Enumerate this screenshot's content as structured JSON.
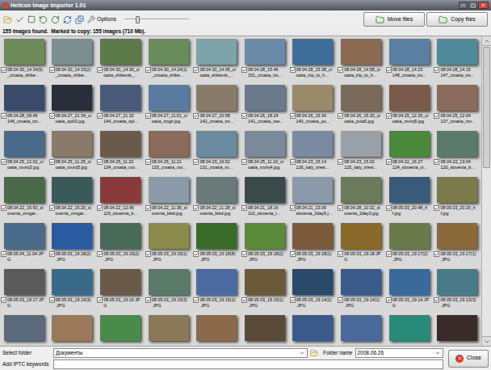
{
  "window": {
    "title": "Helicon Image Importer 1.01"
  },
  "toolbar": {
    "options": "Options",
    "zoom": {
      "level": 0.2
    },
    "buttons": [
      "Move files",
      "Copy files"
    ]
  },
  "status": "155 images found.  Marked to copy: 155 images (710 Mb).",
  "images": [
    {
      "lines": [
        "08.04.30_14.34(5)",
        "_croatia_shibe..."
      ],
      "checked": true,
      "color": "#6f8a5a"
    },
    {
      "lines": [
        "08.04.30_14.33(2)",
        "_croatia_shibe..."
      ],
      "checked": true,
      "color": "#7a8f8e"
    },
    {
      "lines": [
        "08.04.30_14.30_cr",
        "oatia_shibenik_..."
      ],
      "checked": true,
      "color": "#5d7a4a"
    },
    {
      "lines": [
        "08.04.30_14.24(1)",
        "_croatia_shibe..."
      ],
      "checked": true,
      "color": "#6a8c5c"
    },
    {
      "lines": [
        "08.04.30_14.05_cr",
        "oatia_shibenik_..."
      ],
      "checked": true,
      "color": "#7ea3a8"
    },
    {
      "lines": [
        "08.04.28_15.46",
        "151_croatia_tro..."
      ],
      "checked": true,
      "color": "#6b8aa8"
    },
    {
      "lines": [
        "08.04.28_15.38_cr",
        "oatia_trip_to_h..."
      ],
      "checked": true,
      "color": "#3f6d9a"
    },
    {
      "lines": [
        "08.04.28_14.58_cr",
        "oatia_trip_to_h..."
      ],
      "checked": true,
      "color": "#8a6a52"
    },
    {
      "lines": [
        "08.04.28_14.23",
        "148_croatia_tro..."
      ],
      "checked": true,
      "color": "#5a7fa0"
    },
    {
      "lines": [
        "08.04.28_14.15",
        "147_croatia_tro..."
      ],
      "checked": true,
      "color": "#4f8a9a"
    },
    {
      "lines": [
        "08.04.28_09.45",
        "146_croatia_tro..."
      ],
      "checked": true,
      "color": "#3a4a6a"
    },
    {
      "lines": [
        "08.04.27_21.34_cr",
        "oatia_split3.jpg"
      ],
      "checked": true,
      "color": "#2a2e3a"
    },
    {
      "lines": [
        "08.04.27_21.32",
        "144_croatia_spl..."
      ],
      "checked": true,
      "color": "#4a5a7a"
    },
    {
      "lines": [
        "08.04.27_11.01_cr",
        "oatia_trogir.jpg"
      ],
      "checked": true,
      "color": "#5a7aa0"
    },
    {
      "lines": [
        "08.04.27_10.58",
        "142_croatia_tro..."
      ],
      "checked": true,
      "color": "#8a7a6a"
    },
    {
      "lines": [
        "08.04.26_18.24",
        "141_croatia_vse..."
      ],
      "checked": true,
      "color": "#6a7a8a"
    },
    {
      "lines": [
        "08.04.26_15.34",
        "140_croatia_pu..."
      ],
      "checked": true,
      "color": "#9a8a6a"
    },
    {
      "lines": [
        "08.04.26_15.20_cr",
        "oatia_pula5.jpg"
      ],
      "checked": true,
      "color": "#7a6a5a"
    },
    {
      "lines": [
        "08.04.25_12.26_cr",
        "oatia_rovinj5.jpg"
      ],
      "checked": true,
      "color": "#7a5a4a"
    },
    {
      "lines": [
        "08.04.25_12.04",
        "137_croatia_rov..."
      ],
      "checked": true,
      "color": "#8a6a5a"
    },
    {
      "lines": [
        "08.04.25_12.02_cr",
        "oatia_rovinj3.jpg"
      ],
      "checked": true,
      "color": "#4a6a8a"
    },
    {
      "lines": [
        "08.04.25_11.25_cr",
        "oatia_rovinj5.jpg"
      ],
      "checked": true,
      "color": "#8a7a6a"
    },
    {
      "lines": [
        "08.04.25_11.22",
        "134_croatia_rov..."
      ],
      "checked": true,
      "color": "#6a5a4a"
    },
    {
      "lines": [
        "08.04.25_11.21",
        "133_croatia_rov..."
      ],
      "checked": true,
      "color": "#8a6a5a"
    },
    {
      "lines": [
        "08.04.23_16.52",
        "131_croatia_ro..."
      ],
      "checked": true,
      "color": "#6a8aa0"
    },
    {
      "lines": [
        "08.04.25_11.10_cr",
        "oatia_rovinj4.jpg"
      ],
      "checked": true,
      "color": "#7a8a9a"
    },
    {
      "lines": [
        "08.04.23_15.14",
        "126_italy_triest..."
      ],
      "checked": true,
      "color": "#7a8aa0"
    },
    {
      "lines": [
        "08.04.23_15.02",
        "125_italy_triest..."
      ],
      "checked": true,
      "color": "#9aa0a8"
    },
    {
      "lines": [
        "08.04.22_16.27",
        "124_slovenia_vi..."
      ],
      "checked": true,
      "color": "#4a8a3a"
    },
    {
      "lines": [
        "08.04.22_13.04",
        "120_slovenia_b..."
      ],
      "checked": true,
      "color": "#5a7a6a"
    },
    {
      "lines": [
        "08.04.22_15.50_sl",
        "ovenia_vintgar..."
      ],
      "checked": true,
      "color": "#4a6a4a"
    },
    {
      "lines": [
        "08.04.22_15.20_sl",
        "ovenia_vintgar..."
      ],
      "checked": true,
      "color": "#3a5a5a"
    },
    {
      "lines": [
        "08.04.22_12.45",
        "119_slovenia_b..."
      ],
      "checked": true,
      "color": "#8a3a3a"
    },
    {
      "lines": [
        "08.04.22_11.36_sl",
        "ovenia_bled.jpg"
      ],
      "checked": true,
      "color": "#8a9aa8"
    },
    {
      "lines": [
        "08.04.22_11.28_sl",
        "ovenia_bled.jpg"
      ],
      "checked": true,
      "color": "#6a7a7a"
    },
    {
      "lines": [
        "08.04.21_18.16",
        "110_slovenia_l..."
      ],
      "checked": true,
      "color": "#3a4a4a"
    },
    {
      "lines": [
        "08.04.21_13.06",
        "slovenia_2day5.j..."
      ],
      "checked": true,
      "color": "#8a9aaa"
    },
    {
      "lines": [
        "08.04.28_10.32_sl",
        "ovenia_2day3.jpg"
      ],
      "checked": true,
      "color": "#6a7a5a"
    },
    {
      "lines": [
        "08.05.03_20.48_h",
        "f.jpg"
      ],
      "checked": true,
      "color": "#3a5a7a"
    },
    {
      "lines": [
        "08.05.03_20.20_h",
        "f.jpg"
      ],
      "checked": true,
      "color": "#7a7a4a"
    },
    {
      "lines": [
        "08.05.04_11.04.JP",
        "G"
      ],
      "checked": true,
      "color": "#4a6a8a"
    },
    {
      "lines": [
        "08.05.03_19.18(2)",
        ".JPG"
      ],
      "checked": true,
      "color": "#2a5aa0"
    },
    {
      "lines": [
        "08.05.03_19.19(2)",
        ".JPG"
      ],
      "checked": true,
      "color": "#4a6a5a"
    },
    {
      "lines": [
        "08.05.03_19.19(1)",
        ".JPG"
      ],
      "checked": true,
      "color": "#8a8a4a"
    },
    {
      "lines": [
        "08.05.03_19.18(8)",
        ".JPG"
      ],
      "checked": true,
      "color": "#3a6a2a"
    },
    {
      "lines": [
        "08.05.03_19.18(2)",
        ".JPG"
      ],
      "checked": true,
      "color": "#5a8a3a"
    },
    {
      "lines": [
        "08.05.03_19.18(1)",
        ".JPG"
      ],
      "checked": true,
      "color": "#7a5a3a"
    },
    {
      "lines": [
        "08.05.03_19.18.JP",
        "G"
      ],
      "checked": true,
      "color": "#8a6a2a"
    },
    {
      "lines": [
        "08.05.03_19.17(2)",
        ".JPG"
      ],
      "checked": true,
      "color": "#6a7a4a"
    },
    {
      "lines": [
        "08.05.03_19.17(1)",
        ".JPG"
      ],
      "checked": true,
      "color": "#8a6a3a"
    },
    {
      "lines": [
        "08.05.03_19.17.JP",
        "G"
      ],
      "checked": true,
      "color": "#5a5a5a"
    },
    {
      "lines": [
        "08.05.03_19.16(3)",
        ".JPG"
      ],
      "checked": true,
      "color": "#3a6a8a"
    },
    {
      "lines": [
        "08.05.03_19.16.JP",
        "G"
      ],
      "checked": true,
      "color": "#6a5a4a"
    },
    {
      "lines": [
        "08.05.03_19.15(3)",
        ".JPG"
      ],
      "checked": true,
      "color": "#5a7a6a"
    },
    {
      "lines": [
        "08.05.03_19.15(2)",
        ".JPG"
      ],
      "checked": true,
      "color": "#4a6aa0"
    },
    {
      "lines": [
        "08.05.03_19.15(1)",
        ".JPG"
      ],
      "checked": true,
      "color": "#6a5a3a"
    },
    {
      "lines": [
        "08.05.03_19.14(2)",
        ".JPG"
      ],
      "checked": true,
      "color": "#2a4a6a"
    },
    {
      "lines": [
        "08.05.03_19.14(1)",
        ".JPG"
      ],
      "checked": true,
      "color": "#3a5a8a"
    },
    {
      "lines": [
        "08.05.03_19.14.JP",
        "G"
      ],
      "checked": true,
      "color": "#3a6a9a"
    },
    {
      "lines": [
        "08.05.03_19.13(3)",
        ".JPG"
      ],
      "checked": true,
      "color": "#4a7a8a"
    }
  ],
  "partial_row": [
    {
      "color": "#5a6a7a"
    },
    {
      "color": "#9a7a5a"
    },
    {
      "color": "#4a8a4a"
    },
    {
      "color": "#8a7a5a"
    },
    {
      "color": "#8a6a4a"
    },
    {
      "color": "#5a4a3a"
    },
    {
      "color": "#3a5a8a"
    },
    {
      "color": "#4a6a9a"
    },
    {
      "color": "#2a8a7a"
    },
    {
      "color": "#3a2a2a"
    }
  ],
  "footer": {
    "select_folder": {
      "label": "Select folder",
      "value": "Документы"
    },
    "folder_name": {
      "label": "Folder name",
      "value": "2008.06.26"
    },
    "keywords": {
      "label": "Add IPTC keywords",
      "value": ""
    },
    "close": "Close"
  }
}
